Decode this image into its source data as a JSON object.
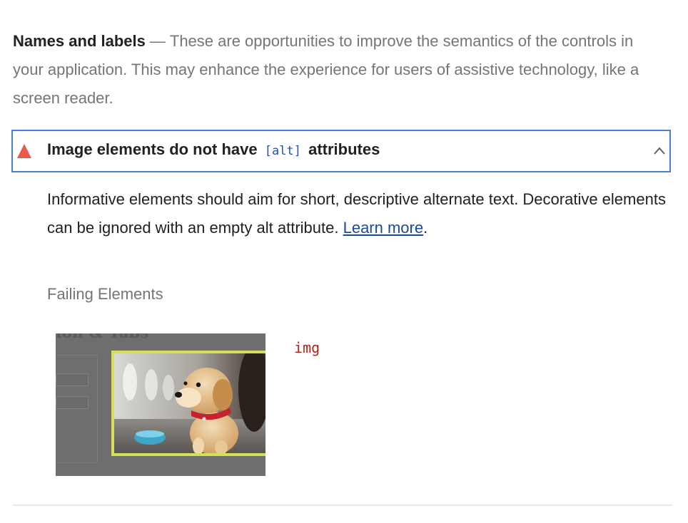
{
  "group": {
    "title": "Names and labels",
    "dash": "—",
    "description": "These are opportunities to improve the semantics of the controls in your application. This may enhance the experience for users of assistive technology, like a screen reader."
  },
  "audit": {
    "title_before": "Image elements do not have",
    "title_code": "[alt]",
    "title_after": "attributes",
    "status_color": "#eb5a46",
    "expanded": true,
    "description": "Informative elements should aim for short, descriptive alternate text. Decorative elements can be ignored with an empty alt attribute.",
    "learn_more": "Learn more",
    "trailing_period": "."
  },
  "failing": {
    "header": "Failing Elements",
    "elements": [
      {
        "selector": "img",
        "thumbnail": "puppy-photo"
      }
    ]
  },
  "colors": {
    "focus_border": "#4a7fd6",
    "highlight": "#d4e157",
    "link": "#1a4b9e",
    "code": "#1a50c9",
    "selector": "#b0261b"
  }
}
